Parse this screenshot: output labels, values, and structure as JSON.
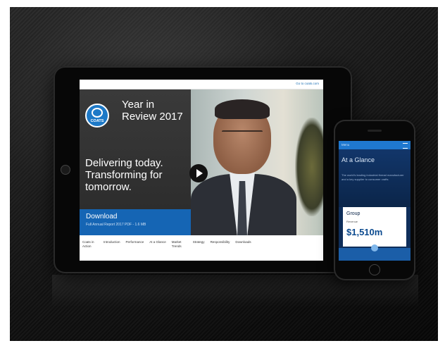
{
  "tablet": {
    "top_link": "Go to coats.com",
    "logo_text": "COATS",
    "hero_title": "Year in Review 2017",
    "tagline": "Delivering today. Transforming for tomorrow.",
    "download": {
      "title": "Download",
      "subtitle": "Full Annual Report 2017 PDF - 1.6 MB"
    },
    "nav": [
      "Coats in Action",
      "Introduction",
      "Performance",
      "At a Glance",
      "Market Trends",
      "Strategy",
      "Responsibility",
      "Downloads"
    ]
  },
  "phone": {
    "top_text": "Menu",
    "title": "At a Glance",
    "body": "The world's leading industrial thread manufacturer and a key supplier to consumer crafts",
    "card": {
      "heading": "Group",
      "label": "Revenue",
      "value": "$1,510m"
    }
  },
  "colors": {
    "brand_blue": "#1565b4",
    "dark_hero": "#2b2b2b",
    "phone_bg": "#0f2e5a"
  }
}
